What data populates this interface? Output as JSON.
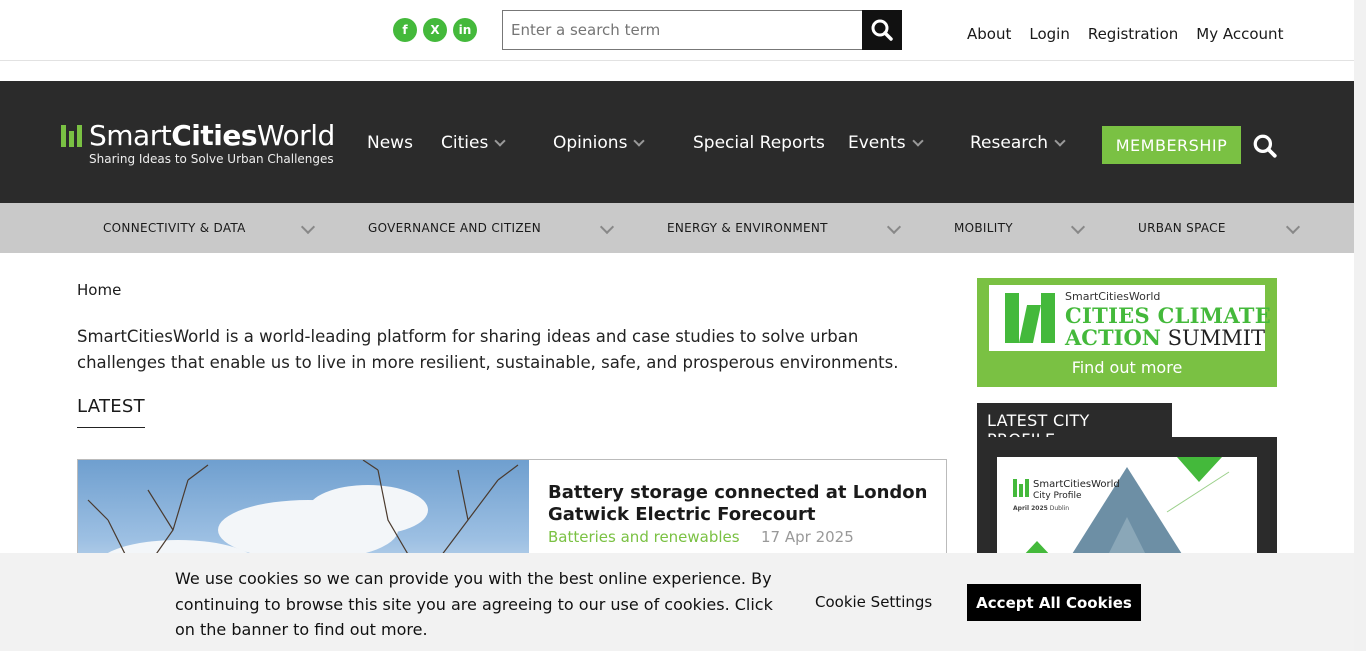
{
  "topbar": {
    "social": [
      {
        "icon": "facebook-icon",
        "glyph": "f"
      },
      {
        "icon": "x-twitter-icon",
        "glyph": "X"
      },
      {
        "icon": "linkedin-icon",
        "glyph": "in"
      }
    ],
    "search_placeholder": "Enter a search term",
    "links": [
      "About",
      "Login",
      "Registration",
      "My Account"
    ]
  },
  "brand": {
    "name_light1": "Smart",
    "name_bold": "Cities",
    "name_light2": "World",
    "tagline": "Sharing Ideas to Solve Urban Challenges",
    "accent": "#7ac143"
  },
  "nav": {
    "items": [
      "News",
      "Cities",
      "Opinions",
      "Special Reports",
      "Events",
      "Research"
    ],
    "membership": "MEMBERSHIP"
  },
  "subnav": [
    "CONNECTIVITY & DATA",
    "GOVERNANCE AND CITIZEN",
    "ENERGY & ENVIRONMENT",
    "MOBILITY",
    "URBAN SPACE"
  ],
  "main": {
    "breadcrumb": "Home",
    "intro": "SmartCitiesWorld is a world-leading platform for sharing ideas and case studies to solve urban challenges that enable us to live in more resilient, sustainable, safe, and prosperous environments.",
    "latest_heading": "LATEST",
    "article": {
      "title": "Battery storage connected at London Gatwick Electric Forecourt",
      "category": "Batteries and renewables",
      "date": "17 Apr 2025"
    }
  },
  "sidebar": {
    "summit_brand": "SmartCitiesWorld",
    "summit_line1": "CITIES CLIMATE",
    "summit_line2_bold": "ACTION",
    "summit_line2": "SUMMIT",
    "summit_cta": "Find out more",
    "profile_heading": "LATEST CITY PROFILE",
    "profile_brand": "SmartCitiesWorld",
    "profile_sub": "City Profile",
    "profile_date": "April 2025",
    "profile_city": "Dublin"
  },
  "cookie": {
    "text": "We use cookies so we can provide you with the best online experience. By continuing to browse this site you are agreeing to our use of cookies. Click on the banner to find out more.",
    "settings": "Cookie Settings",
    "accept": "Accept All Cookies"
  }
}
